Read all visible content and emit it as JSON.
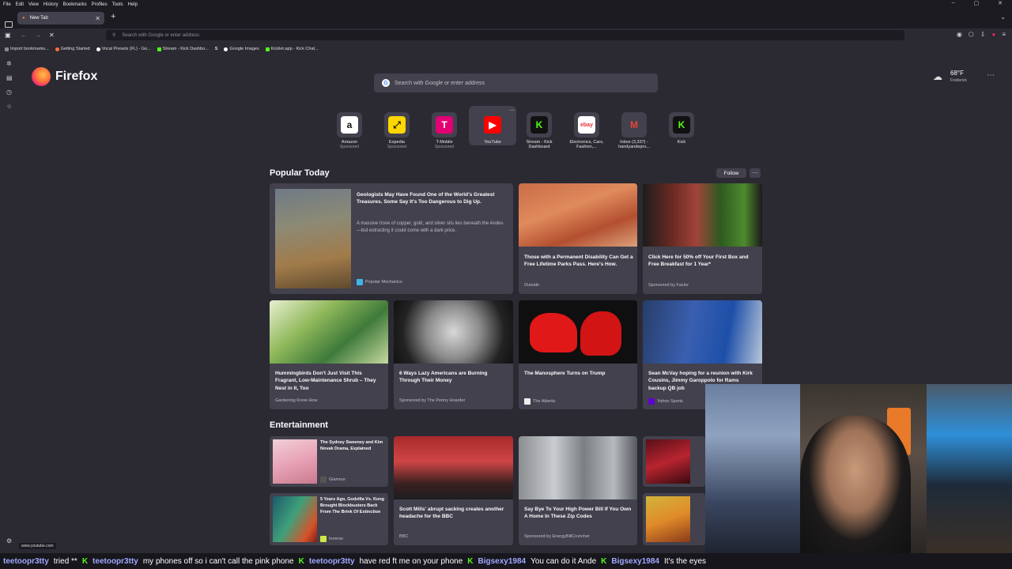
{
  "menu": [
    "File",
    "Edit",
    "View",
    "History",
    "Bookmarks",
    "Profiles",
    "Tools",
    "Help"
  ],
  "tab": {
    "title": "New Tab"
  },
  "urlbar": {
    "placeholder": "Search with Google or enter address"
  },
  "bookmarks": [
    "Import bookmarks...",
    "Getting Started",
    "Vocal Presets (FL) - Go...",
    "Stream - Kick Dashbo...",
    "Google Images",
    "Kicklet.app - Kick Chat..."
  ],
  "brand": {
    "name": "Firefox"
  },
  "weather": {
    "temp": "68°F",
    "city": "Frederick"
  },
  "search": {
    "placeholder": "Search with Google or enter address"
  },
  "shortcuts": [
    {
      "label": "Amazon",
      "sub": "Sponsored",
      "icon": "amazon-icon",
      "color": "#ffffff"
    },
    {
      "label": "Expedia",
      "sub": "Sponsored",
      "icon": "expedia-icon",
      "color": "#ffd700"
    },
    {
      "label": "T-Mobile",
      "sub": "Sponsored",
      "icon": "tmobile-icon",
      "color": "#e20074"
    },
    {
      "label": "YouTube",
      "sub": "",
      "icon": "youtube-icon",
      "color": "#ff0000"
    },
    {
      "label": "Stream - Kick Dashboard",
      "sub": "",
      "icon": "kick-icon",
      "color": "#53fc18"
    },
    {
      "label": "Electronics, Cars, Fashion,...",
      "sub": "",
      "icon": "ebay-icon",
      "color": "#ffffff"
    },
    {
      "label": "Inbox (3,337) - handyandepro...",
      "sub": "",
      "icon": "gmail-icon",
      "color": "#ffffff"
    },
    {
      "label": "Kick",
      "sub": "",
      "icon": "kick-icon",
      "color": "#53fc18"
    }
  ],
  "popular": {
    "title": "Popular Today",
    "follow": "Follow"
  },
  "cards": {
    "c1": {
      "headline": "Geologists May Have Found One of the World's Greatest Treasures. Some Say It's Too Dangerous to Dig Up.",
      "desc": "A massive trove of copper, gold, and silver sits lies beneath the Andes—but extracting it could come with a dark price.",
      "source": "Popular Mechanics"
    },
    "c2": {
      "headline": "Those with a Permanent Disability Can Get a Free Lifetime Parks Pass. Here's How.",
      "source": "Outside"
    },
    "c3": {
      "headline": "Click Here for 50% off Your First Box and Free Breakfast for 1 Year*",
      "source": "Sponsored by Factor"
    },
    "c4": {
      "headline": "Hummingbirds Don't Just Visit This Fragrant, Low-Maintenance Shrub – They Nest in It, Too",
      "source": "Gardening Know How"
    },
    "c5": {
      "headline": "6 Ways Lazy Americans are Burning Through Their Money",
      "source": "Sponsored by The Penny Hoarder"
    },
    "c6": {
      "headline": "The Manosphere Turns on Trump",
      "source": "The Atlantic"
    },
    "c7": {
      "headline": "Sean McVay hoping for a reunion with Kirk Cousins, Jimmy Garoppolo for Rams backup QB job",
      "source": "Yahoo Sports"
    }
  },
  "entertainment": {
    "title": "Entertainment"
  },
  "ent_cards": {
    "e1": {
      "headline": "The Sydney Sweeney and Kim Novak Drama, Explained",
      "source": "Glamour"
    },
    "e2": {
      "headline": "5 Years Ago, Godzilla Vs. Kong Brought Blockbusters Back From The Brink Of Extinction",
      "source": "Inverse"
    },
    "e3": {
      "headline": "Scott Mills' abrupt sacking creates another headache for the BBC",
      "source": "BBC"
    },
    "e4": {
      "headline": "Say Bye To Your High Power Bill If You Own A Home In These Zip Codes",
      "source": "Sponsored by EnergyBillCruncher"
    }
  },
  "status_url": "www.youtube.com",
  "chat": [
    {
      "user": "teetoopr3tty",
      "msg": "tried **"
    },
    {
      "user": "teetoopr3tty",
      "msg": "my phones off so i can't call the pink phone"
    },
    {
      "user": "teetoopr3tty",
      "msg": "have red ft me on your phone"
    },
    {
      "user": "Bigsexy1984",
      "msg": "You can do it Ande"
    },
    {
      "user": "Bigsexy1984",
      "msg": "It's the eyes"
    }
  ]
}
